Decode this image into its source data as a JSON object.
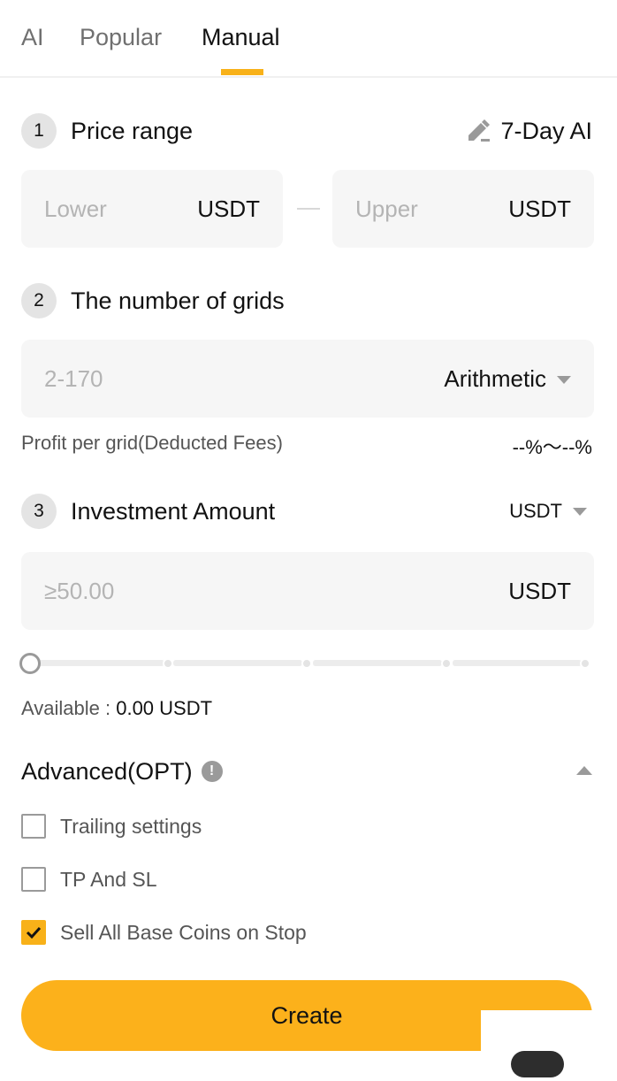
{
  "tabs": [
    {
      "label": "AI",
      "active": false
    },
    {
      "label": "Popular",
      "active": false
    },
    {
      "label": "Manual",
      "active": true
    }
  ],
  "price_range": {
    "step": "1",
    "title": "Price range",
    "ai_link": "7-Day AI",
    "lower_placeholder": "Lower",
    "upper_placeholder": "Upper",
    "unit": "USDT"
  },
  "grids": {
    "step": "2",
    "title": "The number of grids",
    "placeholder": "2-170",
    "mode": "Arithmetic",
    "profit_label": "Profit per grid(Deducted Fees)",
    "profit_value": "--%～--%"
  },
  "investment": {
    "step": "3",
    "title": "Investment Amount",
    "currency": "USDT",
    "placeholder": "≥50.00",
    "unit": "USDT",
    "slider_percent": 0,
    "available_label": "Available : ",
    "available_value": "0.00 USDT"
  },
  "advanced": {
    "title": "Advanced(OPT)",
    "options": [
      {
        "label": "Trailing settings",
        "checked": false
      },
      {
        "label": "TP And SL",
        "checked": false
      },
      {
        "label": "Sell All Base Coins on Stop",
        "checked": true
      }
    ]
  },
  "create_label": "Create",
  "colors": {
    "accent": "#f8b119",
    "button": "#fcb11b",
    "field_bg": "#f6f6f6"
  }
}
